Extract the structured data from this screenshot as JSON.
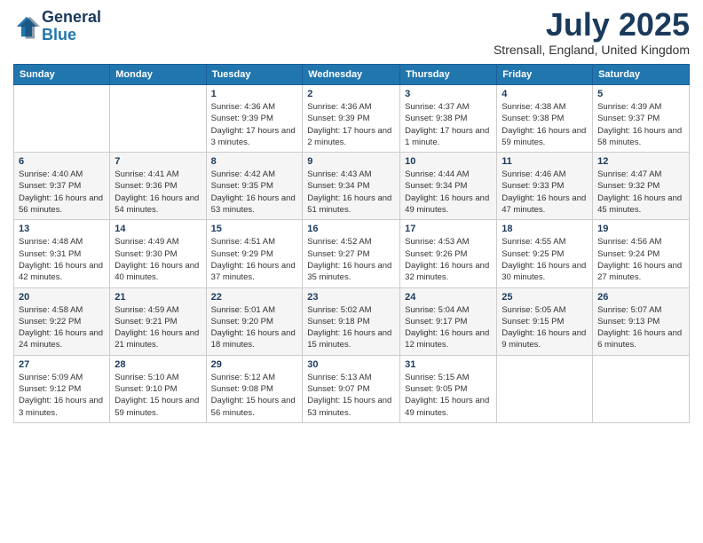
{
  "logo": {
    "line1": "General",
    "line2": "Blue"
  },
  "title": "July 2025",
  "location": "Strensall, England, United Kingdom",
  "days_of_week": [
    "Sunday",
    "Monday",
    "Tuesday",
    "Wednesday",
    "Thursday",
    "Friday",
    "Saturday"
  ],
  "weeks": [
    [
      {
        "day": "",
        "info": ""
      },
      {
        "day": "",
        "info": ""
      },
      {
        "day": "1",
        "info": "Sunrise: 4:36 AM\nSunset: 9:39 PM\nDaylight: 17 hours\nand 3 minutes."
      },
      {
        "day": "2",
        "info": "Sunrise: 4:36 AM\nSunset: 9:39 PM\nDaylight: 17 hours\nand 2 minutes."
      },
      {
        "day": "3",
        "info": "Sunrise: 4:37 AM\nSunset: 9:38 PM\nDaylight: 17 hours\nand 1 minute."
      },
      {
        "day": "4",
        "info": "Sunrise: 4:38 AM\nSunset: 9:38 PM\nDaylight: 16 hours\nand 59 minutes."
      },
      {
        "day": "5",
        "info": "Sunrise: 4:39 AM\nSunset: 9:37 PM\nDaylight: 16 hours\nand 58 minutes."
      }
    ],
    [
      {
        "day": "6",
        "info": "Sunrise: 4:40 AM\nSunset: 9:37 PM\nDaylight: 16 hours\nand 56 minutes."
      },
      {
        "day": "7",
        "info": "Sunrise: 4:41 AM\nSunset: 9:36 PM\nDaylight: 16 hours\nand 54 minutes."
      },
      {
        "day": "8",
        "info": "Sunrise: 4:42 AM\nSunset: 9:35 PM\nDaylight: 16 hours\nand 53 minutes."
      },
      {
        "day": "9",
        "info": "Sunrise: 4:43 AM\nSunset: 9:34 PM\nDaylight: 16 hours\nand 51 minutes."
      },
      {
        "day": "10",
        "info": "Sunrise: 4:44 AM\nSunset: 9:34 PM\nDaylight: 16 hours\nand 49 minutes."
      },
      {
        "day": "11",
        "info": "Sunrise: 4:46 AM\nSunset: 9:33 PM\nDaylight: 16 hours\nand 47 minutes."
      },
      {
        "day": "12",
        "info": "Sunrise: 4:47 AM\nSunset: 9:32 PM\nDaylight: 16 hours\nand 45 minutes."
      }
    ],
    [
      {
        "day": "13",
        "info": "Sunrise: 4:48 AM\nSunset: 9:31 PM\nDaylight: 16 hours\nand 42 minutes."
      },
      {
        "day": "14",
        "info": "Sunrise: 4:49 AM\nSunset: 9:30 PM\nDaylight: 16 hours\nand 40 minutes."
      },
      {
        "day": "15",
        "info": "Sunrise: 4:51 AM\nSunset: 9:29 PM\nDaylight: 16 hours\nand 37 minutes."
      },
      {
        "day": "16",
        "info": "Sunrise: 4:52 AM\nSunset: 9:27 PM\nDaylight: 16 hours\nand 35 minutes."
      },
      {
        "day": "17",
        "info": "Sunrise: 4:53 AM\nSunset: 9:26 PM\nDaylight: 16 hours\nand 32 minutes."
      },
      {
        "day": "18",
        "info": "Sunrise: 4:55 AM\nSunset: 9:25 PM\nDaylight: 16 hours\nand 30 minutes."
      },
      {
        "day": "19",
        "info": "Sunrise: 4:56 AM\nSunset: 9:24 PM\nDaylight: 16 hours\nand 27 minutes."
      }
    ],
    [
      {
        "day": "20",
        "info": "Sunrise: 4:58 AM\nSunset: 9:22 PM\nDaylight: 16 hours\nand 24 minutes."
      },
      {
        "day": "21",
        "info": "Sunrise: 4:59 AM\nSunset: 9:21 PM\nDaylight: 16 hours\nand 21 minutes."
      },
      {
        "day": "22",
        "info": "Sunrise: 5:01 AM\nSunset: 9:20 PM\nDaylight: 16 hours\nand 18 minutes."
      },
      {
        "day": "23",
        "info": "Sunrise: 5:02 AM\nSunset: 9:18 PM\nDaylight: 16 hours\nand 15 minutes."
      },
      {
        "day": "24",
        "info": "Sunrise: 5:04 AM\nSunset: 9:17 PM\nDaylight: 16 hours\nand 12 minutes."
      },
      {
        "day": "25",
        "info": "Sunrise: 5:05 AM\nSunset: 9:15 PM\nDaylight: 16 hours\nand 9 minutes."
      },
      {
        "day": "26",
        "info": "Sunrise: 5:07 AM\nSunset: 9:13 PM\nDaylight: 16 hours\nand 6 minutes."
      }
    ],
    [
      {
        "day": "27",
        "info": "Sunrise: 5:09 AM\nSunset: 9:12 PM\nDaylight: 16 hours\nand 3 minutes."
      },
      {
        "day": "28",
        "info": "Sunrise: 5:10 AM\nSunset: 9:10 PM\nDaylight: 15 hours\nand 59 minutes."
      },
      {
        "day": "29",
        "info": "Sunrise: 5:12 AM\nSunset: 9:08 PM\nDaylight: 15 hours\nand 56 minutes."
      },
      {
        "day": "30",
        "info": "Sunrise: 5:13 AM\nSunset: 9:07 PM\nDaylight: 15 hours\nand 53 minutes."
      },
      {
        "day": "31",
        "info": "Sunrise: 5:15 AM\nSunset: 9:05 PM\nDaylight: 15 hours\nand 49 minutes."
      },
      {
        "day": "",
        "info": ""
      },
      {
        "day": "",
        "info": ""
      }
    ]
  ]
}
